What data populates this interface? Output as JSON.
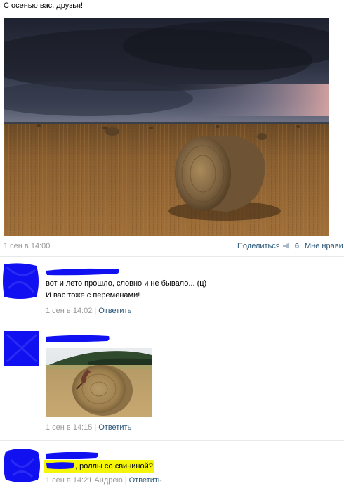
{
  "post": {
    "text": "С осенью вас, друзья!",
    "date": "1 сен в 14:00",
    "share_label": "Поделиться",
    "share_count": "6",
    "like_label": "Мне нрави"
  },
  "comments": [
    {
      "line1": "вот и лето прошло, словно и не бывало... (ц)",
      "line2": "И вас тоже с переменами!",
      "date": "1 сен в 14:02",
      "reply_label": "Ответить"
    },
    {
      "date": "1 сен в 14:15",
      "reply_label": "Ответить"
    },
    {
      "text_highlight": ", роллы со свининой?",
      "date": "1 сен в 14:21",
      "reply_to": "Андрею",
      "reply_label": "Ответить"
    }
  ],
  "colors": {
    "link": "#2b587a",
    "meta": "#999999",
    "redaction_blue": "#1010f0",
    "highlight_yellow": "#f5f50a"
  }
}
